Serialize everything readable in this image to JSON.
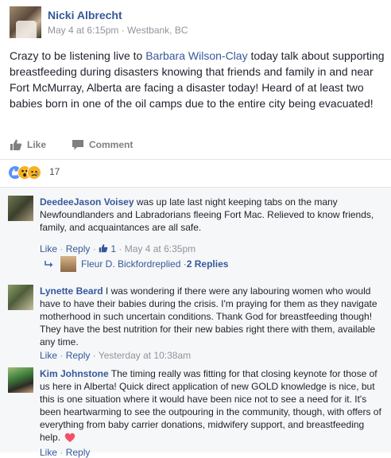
{
  "post": {
    "author": "Nicki Albrecht",
    "meta": "May 4 at 6:15pm · Westbank, BC",
    "text_before": "Crazy to be listening live to ",
    "text_link": "Barbara Wilson-Clay",
    "text_after": " today talk about supporting breastfeeding during disasters knowing that friends and family in and near Fort McMurray, Alberta are facing a disaster today! Heard of at least two babies born in one of the oil camps due to the entire city being evacuated!"
  },
  "actions": {
    "like": "Like",
    "comment": "Comment"
  },
  "reactions": {
    "count": "17"
  },
  "comments": [
    {
      "name": "DeedeeJason Voisey",
      "text": " was up late last night keeping tabs on the many Newfoundlanders and Labradorians fleeing Fort Mac. Relieved to know friends, family, and acquaintances are all safe.",
      "like": "Like",
      "reply": "Reply",
      "likes": "1",
      "time": "May 4 at 6:35pm",
      "reply_summary": {
        "name": "Fleur D. Bickford",
        "replied": " replied · ",
        "count": "2 Replies"
      }
    },
    {
      "name": "Lynette Beard",
      "text": " I was wondering if there were any labouring women who would have to have their babies during the crisis. I'm praying for them as they navigate motherhood in such uncertain conditions. Thank God for breastfeeding though! They have the best nutrition for their new babies right there with them, available any time.",
      "like": "Like",
      "reply": "Reply",
      "time": "Yesterday at 10:38am"
    },
    {
      "name": "Kim Johnstone",
      "text": " The timing really was fitting for that closing keynote for those of us here in Alberta! Quick direct application of new GOLD knowledge is nice, but this is one situation where it would have been nice not to see a need for it. It's been heartwarming to see the outpouring in the community, though, with offers of everything from baby carrier donations, midwifery support, and breastfeeding help.",
      "like": "Like",
      "reply": "Reply"
    }
  ],
  "icons": [
    "thumbs-up-icon",
    "comment-icon",
    "like-reaction-icon",
    "wow-reaction-icon",
    "sad-reaction-icon",
    "reply-arrow-icon",
    "heart-icon"
  ],
  "colors": {
    "link": "#365899",
    "muted": "#90949c",
    "comment_bg": "#f6f7f9",
    "like_blue": "#5890ff",
    "reaction_yellow": "#f7b125",
    "heart": "#f25268"
  }
}
